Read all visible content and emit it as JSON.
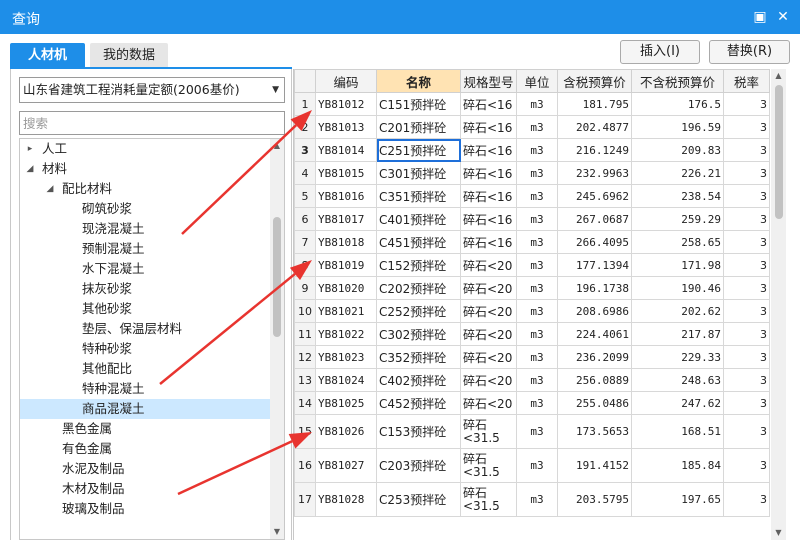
{
  "window": {
    "title": "查询",
    "restore_glyph": "▣",
    "close_glyph": "✕"
  },
  "tabs": [
    {
      "label": "人材机",
      "active": true
    },
    {
      "label": "我的数据",
      "active": false
    }
  ],
  "buttons": {
    "insert": "插入(I)",
    "replace": "替换(R)"
  },
  "quota_select": {
    "value": "山东省建筑工程消耗量定额(2006基价)"
  },
  "search": {
    "placeholder": "搜索"
  },
  "tree": [
    {
      "label": "人工",
      "level": 0,
      "toggle": "▸"
    },
    {
      "label": "材料",
      "level": 0,
      "toggle": "◢"
    },
    {
      "label": "配比材料",
      "level": 1,
      "toggle": "◢"
    },
    {
      "label": "砌筑砂浆",
      "level": 2,
      "toggle": ""
    },
    {
      "label": "现浇混凝土",
      "level": 2,
      "toggle": ""
    },
    {
      "label": "预制混凝土",
      "level": 2,
      "toggle": ""
    },
    {
      "label": "水下混凝土",
      "level": 2,
      "toggle": ""
    },
    {
      "label": "抹灰砂浆",
      "level": 2,
      "toggle": ""
    },
    {
      "label": "其他砂浆",
      "level": 2,
      "toggle": ""
    },
    {
      "label": "垫层、保温层材料",
      "level": 2,
      "toggle": ""
    },
    {
      "label": "特种砂浆",
      "level": 2,
      "toggle": ""
    },
    {
      "label": "其他配比",
      "level": 2,
      "toggle": ""
    },
    {
      "label": "特种混凝土",
      "level": 2,
      "toggle": ""
    },
    {
      "label": "商品混凝土",
      "level": 2,
      "toggle": "",
      "selected": true
    },
    {
      "label": "黑色金属",
      "level": 1,
      "toggle": ""
    },
    {
      "label": "有色金属",
      "level": 1,
      "toggle": ""
    },
    {
      "label": "水泥及制品",
      "level": 1,
      "toggle": ""
    },
    {
      "label": "木材及制品",
      "level": 1,
      "toggle": ""
    },
    {
      "label": "玻璃及制品",
      "level": 1,
      "toggle": ""
    }
  ],
  "grid": {
    "columns": [
      "",
      "编码",
      "名称",
      "规格型号",
      "单位",
      "含税预算价",
      "不含税预算价",
      "税率"
    ],
    "highlighted_column": 2,
    "current_row": 3,
    "rows": [
      {
        "no": "1",
        "code": "YB81012",
        "name": "C151预拌砼",
        "spec": "碎石<16",
        "unit": "m3",
        "price_tax": "181.795",
        "price_notax": "176.5",
        "rate": "3"
      },
      {
        "no": "2",
        "code": "YB81013",
        "name": "C201预拌砼",
        "spec": "碎石<16",
        "unit": "m3",
        "price_tax": "202.4877",
        "price_notax": "196.59",
        "rate": "3"
      },
      {
        "no": "3",
        "code": "YB81014",
        "name": "C251预拌砼",
        "spec": "碎石<16",
        "unit": "m3",
        "price_tax": "216.1249",
        "price_notax": "209.83",
        "rate": "3"
      },
      {
        "no": "4",
        "code": "YB81015",
        "name": "C301预拌砼",
        "spec": "碎石<16",
        "unit": "m3",
        "price_tax": "232.9963",
        "price_notax": "226.21",
        "rate": "3"
      },
      {
        "no": "5",
        "code": "YB81016",
        "name": "C351预拌砼",
        "spec": "碎石<16",
        "unit": "m3",
        "price_tax": "245.6962",
        "price_notax": "238.54",
        "rate": "3"
      },
      {
        "no": "6",
        "code": "YB81017",
        "name": "C401预拌砼",
        "spec": "碎石<16",
        "unit": "m3",
        "price_tax": "267.0687",
        "price_notax": "259.29",
        "rate": "3"
      },
      {
        "no": "7",
        "code": "YB81018",
        "name": "C451预拌砼",
        "spec": "碎石<16",
        "unit": "m3",
        "price_tax": "266.4095",
        "price_notax": "258.65",
        "rate": "3"
      },
      {
        "no": "8",
        "code": "YB81019",
        "name": "C152预拌砼",
        "spec": "碎石<20",
        "unit": "m3",
        "price_tax": "177.1394",
        "price_notax": "171.98",
        "rate": "3"
      },
      {
        "no": "9",
        "code": "YB81020",
        "name": "C202预拌砼",
        "spec": "碎石<20",
        "unit": "m3",
        "price_tax": "196.1738",
        "price_notax": "190.46",
        "rate": "3"
      },
      {
        "no": "10",
        "code": "YB81021",
        "name": "C252预拌砼",
        "spec": "碎石<20",
        "unit": "m3",
        "price_tax": "208.6986",
        "price_notax": "202.62",
        "rate": "3"
      },
      {
        "no": "11",
        "code": "YB81022",
        "name": "C302预拌砼",
        "spec": "碎石<20",
        "unit": "m3",
        "price_tax": "224.4061",
        "price_notax": "217.87",
        "rate": "3"
      },
      {
        "no": "12",
        "code": "YB81023",
        "name": "C352预拌砼",
        "spec": "碎石<20",
        "unit": "m3",
        "price_tax": "236.2099",
        "price_notax": "229.33",
        "rate": "3"
      },
      {
        "no": "13",
        "code": "YB81024",
        "name": "C402预拌砼",
        "spec": "碎石<20",
        "unit": "m3",
        "price_tax": "256.0889",
        "price_notax": "248.63",
        "rate": "3"
      },
      {
        "no": "14",
        "code": "YB81025",
        "name": "C452预拌砼",
        "spec": "碎石<20",
        "unit": "m3",
        "price_tax": "255.0486",
        "price_notax": "247.62",
        "rate": "3"
      },
      {
        "no": "15",
        "code": "YB81026",
        "name": "C153预拌砼",
        "spec": "碎石<31.5",
        "unit": "m3",
        "price_tax": "173.5653",
        "price_notax": "168.51",
        "rate": "3"
      },
      {
        "no": "16",
        "code": "YB81027",
        "name": "C203预拌砼",
        "spec": "碎石<31.5",
        "unit": "m3",
        "price_tax": "191.4152",
        "price_notax": "185.84",
        "rate": "3"
      },
      {
        "no": "17",
        "code": "YB81028",
        "name": "C253预拌砼",
        "spec": "碎石<31.5",
        "unit": "m3",
        "price_tax": "203.5795",
        "price_notax": "197.65",
        "rate": "3"
      }
    ]
  },
  "colors": {
    "accent": "#1e8ee8",
    "annotation_arrow": "#e8342f",
    "selected_node": "#cce8ff",
    "highlighted_header": "#ffe3b3"
  }
}
